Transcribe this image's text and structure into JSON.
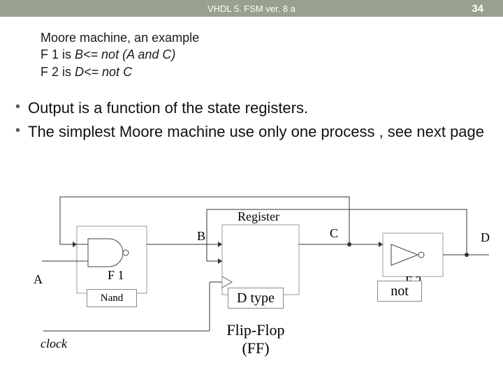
{
  "header": {
    "title": "VHDL 5. FSM ver. 8 a",
    "page_number": "34"
  },
  "title_block": {
    "line1": "Moore machine, an example",
    "line2_prefix": "F 1 is ",
    "line2_em": "B<= not (A and C)",
    "line3_prefix": "F 2 is ",
    "line3_em": "D<= not C"
  },
  "bullets": [
    "Output is a function of the state registers.",
    "The simplest Moore machine use only one process , see next page"
  ],
  "diagram": {
    "labels": {
      "A": "A",
      "B": "B",
      "C": "C",
      "D": "D",
      "F1": "F 1",
      "F2": "F 2",
      "Register": "Register",
      "clock": "clock"
    },
    "boxes": {
      "nand": "Nand",
      "dtype": "D type",
      "not": "not"
    },
    "ff_caption": {
      "l1": "Flip-Flop",
      "l2": "(FF)"
    }
  }
}
